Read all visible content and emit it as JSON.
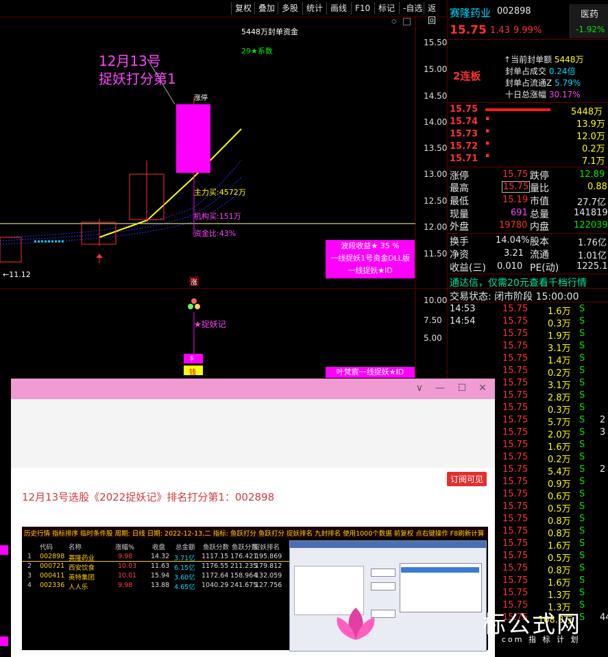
{
  "toolbar": {
    "buttons": [
      "复权",
      "叠加",
      "多股",
      "统计",
      "画线",
      "F10",
      "标记",
      "-自选",
      "返回"
    ]
  },
  "chart": {
    "price_axis": [
      "15.50",
      "15.00",
      "14.50",
      "14.00",
      "13.50",
      "13.00",
      "12.50",
      "12.00",
      "11.50"
    ],
    "sub_axis": [
      "10.00",
      "7.50",
      "5.00"
    ],
    "annotation_title_line1": "12月13号",
    "annotation_title_line2": "捉妖打分第1",
    "top_label": "5448万封单资金",
    "coef_label": "29★系数",
    "candle_tag": "涨停",
    "main_buy": "主力买:4572万",
    "inst_buy": "机构买:151万",
    "fund_ratio": "资金比:43%",
    "low_price": "11.12",
    "info_box": [
      "波段收益★ 35 %",
      "一线捉妖1号资金DLL版",
      "一线捉妖★ID"
    ],
    "zhang_mark": "涨",
    "sub_label": "★捉妖记",
    "sub_box": "叶梵宸一线捉妖★ID",
    "coin_char": "钱"
  },
  "quote": {
    "name": "赛隆药业",
    "code": "002898",
    "sector": "医药",
    "sector_change": "-1.92%",
    "price": "15.75",
    "change": "1.43",
    "change_pct": "9.99%",
    "board_count": "2连板",
    "seal_rows": [
      {
        "label": "当前封单额",
        "value": "5448万"
      },
      {
        "label": "封单占成交",
        "value": "0.24倍"
      },
      {
        "label": "封单占流通Z",
        "value": "5.79%"
      },
      {
        "label": "十日总涨幅",
        "value": "30.17%"
      }
    ],
    "book": [
      {
        "price": "15.75",
        "vol": "5448万"
      },
      {
        "price": "15.74",
        "vol": "13.9万"
      },
      {
        "price": "15.73",
        "vol": "12.0万"
      },
      {
        "price": "15.72",
        "vol": "0.2万"
      },
      {
        "price": "15.71",
        "vol": "7.1万"
      }
    ],
    "stats": [
      {
        "l1": "涨停",
        "v1": "15.75",
        "l2": "跌停",
        "v2": "12.89"
      },
      {
        "l1": "最高",
        "v1": "15.75",
        "l2": "量比",
        "v2": "0.88"
      },
      {
        "l1": "最低",
        "v1": "15.19",
        "l2": "市值",
        "v2": "27.7亿"
      },
      {
        "l1": "现量",
        "v1": "691",
        "l2": "总量",
        "v2": "141819"
      },
      {
        "l1": "外盘",
        "v1": "19780",
        "l2": "内盘",
        "v2": "122039"
      }
    ],
    "fund": [
      {
        "l1": "换手",
        "v1": "14.04%",
        "l2": "股本",
        "v2": "1.76亿"
      },
      {
        "l1": "净资",
        "v1": "3.21",
        "l2": "流通",
        "v2": "1.01亿"
      },
      {
        "l1": "收益(三)",
        "v1": "0.010",
        "l2": "PE(动)",
        "v2": "1225.1"
      }
    ],
    "ad_text": "通达信，仅需20元查看千档行情",
    "trade_status": "交易状态: 闭市阶段 15:00:00",
    "ticks": [
      {
        "t": "14:53",
        "p": "15.75",
        "v": "1.6万",
        "s": "S"
      },
      {
        "t": "14:54",
        "p": "15.75",
        "v": "0.3万",
        "s": "S"
      },
      {
        "t": "",
        "p": "15.75",
        "v": "1.9万",
        "s": "S"
      },
      {
        "t": "",
        "p": "15.75",
        "v": "3.1万",
        "s": "S"
      },
      {
        "t": "",
        "p": "15.75",
        "v": "1.4万",
        "s": "S"
      },
      {
        "t": "",
        "p": "15.75",
        "v": "0.2万",
        "s": "S"
      },
      {
        "t": "",
        "p": "15.75",
        "v": "3.1万",
        "s": "S"
      },
      {
        "t": "",
        "p": "15.75",
        "v": "2.8万",
        "s": "S"
      },
      {
        "t": "",
        "p": "15.75",
        "v": "0.3万",
        "s": "S"
      },
      {
        "t": "",
        "p": "15.75",
        "v": "5.7万",
        "s": "S",
        "x": "2"
      },
      {
        "t": "",
        "p": "15.75",
        "v": "2.0万",
        "s": "S",
        "x": "3"
      },
      {
        "t": "",
        "p": "15.75",
        "v": "1.6万",
        "s": "S"
      },
      {
        "t": "",
        "p": "15.75",
        "v": "0.2万",
        "s": "S"
      },
      {
        "t": "",
        "p": "15.75",
        "v": "5.4万",
        "s": "S",
        "x": "2"
      },
      {
        "t": "",
        "p": "15.75",
        "v": "0.9万",
        "s": "S"
      },
      {
        "t": "",
        "p": "15.75",
        "v": "0.6万",
        "s": "S"
      },
      {
        "t": "",
        "p": "15.75",
        "v": "0.5万",
        "s": "S"
      },
      {
        "t": "",
        "p": "15.75",
        "v": "0.8万",
        "s": "S"
      },
      {
        "t": "",
        "p": "15.75",
        "v": "0.8万",
        "s": "S"
      },
      {
        "t": "",
        "p": "15.75",
        "v": "1.6万",
        "s": "S"
      },
      {
        "t": "",
        "p": "15.75",
        "v": "0.5万",
        "s": "S"
      },
      {
        "t": "",
        "p": "15.75",
        "v": "0.8万",
        "s": "S"
      },
      {
        "t": "",
        "p": "15.75",
        "v": "1.6万",
        "s": "S"
      },
      {
        "t": "",
        "p": "15.75",
        "v": "1.3万",
        "s": "S"
      },
      {
        "t": "",
        "p": "15.75",
        "v": "1.3万",
        "s": "S"
      },
      {
        "t": "",
        "p": "15.75",
        "v": "108.8万",
        "s": "S",
        "x": "44"
      }
    ]
  },
  "popup": {
    "tag": "订阅可见",
    "title": "12月13号选股《2022捉妖记》排名打分第1：002898",
    "inner_header": "历史行情 指标排序 临时条件股 周期: 日线 日期: 2022-12-13,二 指标: 鱼跃打分 鱼跃打分 捉妖排名 九封排名 使用1000个数据 前复权 点右键操作 F8刷新计算",
    "inner_cols": [
      "代码",
      "名称",
      "涨幅%",
      "收盘",
      "总金额",
      "鱼跃分数",
      "鱼跃分数",
      "捉妖排名"
    ],
    "inner_rows": [
      [
        "1",
        "002898",
        "赛隆药业",
        "9.98",
        "14.32",
        "3.71亿",
        "1117.15",
        "176.421",
        "195.869"
      ],
      [
        "2",
        "000721",
        "西安饮食",
        "10.03",
        "11.63",
        "6.15亿",
        "1176.55",
        "211.235",
        "179.812"
      ],
      [
        "3",
        "000411",
        "英特集团",
        "10.01",
        "15.94",
        "3.60亿",
        "1172.64",
        "158.964",
        "132.059"
      ],
      [
        "4",
        "002336",
        "人人乐",
        "9.98",
        "13.88",
        "4.65亿",
        "1040.29",
        "241.675",
        "127.756"
      ]
    ]
  },
  "watermark": {
    "text": "标公式网",
    "sub": "com 指 标 计 划"
  },
  "colors": {
    "up": "#ff3232",
    "down": "#00e600",
    "accent": "#ff00ff",
    "popup_bar": "#f09bd2"
  }
}
